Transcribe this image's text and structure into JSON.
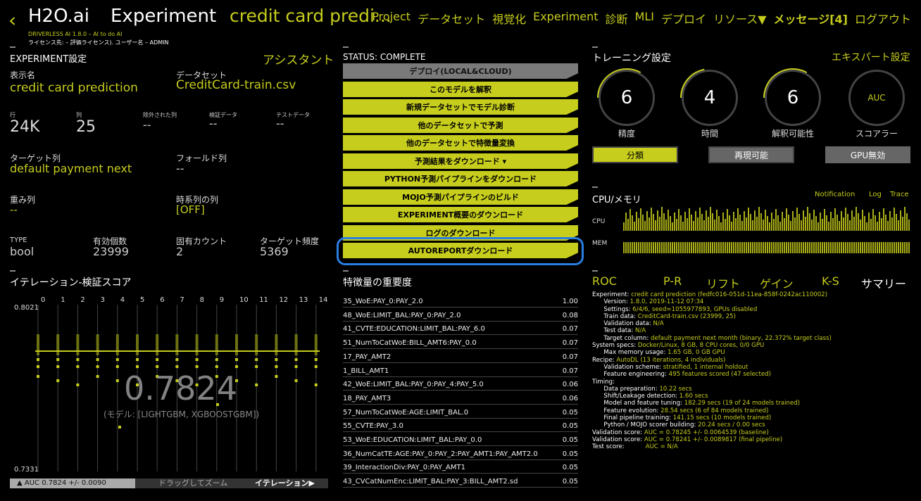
{
  "header": {
    "back_icon": "‹",
    "brand": "H2O.ai",
    "nav_experiment": "Experiment",
    "experiment_name": "credit card predi...",
    "version_line": "DRIVERLESS AI 1.8.0 – AI to do AI",
    "license_line": "ライセンス先:                – 評価ライセンス). ユーザー名 – ADMIN",
    "nav": [
      "Project",
      "データセット",
      "視覚化",
      "Experiment",
      "診断",
      "MLI",
      "デプロイ",
      "リソース▼",
      "メッセージ[4]",
      "ログアウト"
    ]
  },
  "settings": {
    "title": "EXPERIMENT設定",
    "assistant": "アシスタント",
    "display_name_label": "表示名",
    "display_name": "credit card prediction",
    "dataset_label": "データセット",
    "dataset": "CreditCard-train.csv",
    "rows_label": "行",
    "rows": "24K",
    "cols_label": "列",
    "cols": "25",
    "excluded_label": "除外された列",
    "excluded": "--",
    "validation_label": "検証データ",
    "validation": "--",
    "test_label": "テストデータ",
    "test": "--",
    "target_label": "ターゲット列",
    "target": "default payment next",
    "fold_label": "フォールド列",
    "fold": "--",
    "weight_label": "重み列",
    "weight": "--",
    "time_label": "時系列の列",
    "time": "[OFF]",
    "type_label": "TYPE",
    "type": "bool",
    "count_label": "有効個数",
    "count": "23999",
    "unique_label": "固有カウント",
    "unique": "2",
    "freq_label": "ターゲット頻度",
    "freq": "5369"
  },
  "iteration": {
    "title": "イテレーション-検証スコア",
    "ymax": "0.8021",
    "ymin": "0.7331",
    "score": "0.7824",
    "model": "(モデル: [LIGHTGBM, XGBOOSTGBM])",
    "ticks": [
      "0",
      "1",
      "2",
      "3",
      "4",
      "5",
      "6",
      "7",
      "8",
      "9",
      "10",
      "11",
      "12",
      "13",
      "14"
    ],
    "footer_left": "▲ AUC 0.7824 +/- 0.0090",
    "footer_mid": "ドラッグしてズーム",
    "footer_right": "イテレーション▶"
  },
  "status": {
    "title": "STATUS: COMPLETE",
    "buttons": [
      "デプロイ(LOCAL&CLOUD)",
      "このモデルを解釈",
      "新規データセットでモデル診断",
      "他のデータセットで予測",
      "他のデータセットで特徴量変換",
      "予測結果をダウンロード ▾",
      "PYTHON予測パイプラインをダウンロード",
      "MOJO予測パイプラインのビルド",
      "EXPERIMENT概要のダウンロード",
      "ログのダウンロード",
      "AUTOREPORTダウンロード"
    ]
  },
  "features": {
    "title": "特徴量の重要度",
    "rows": [
      [
        "35_WoE:PAY_0:PAY_2.0",
        "1.00"
      ],
      [
        "48_WoE:LIMIT_BAL:PAY_0:PAY_2.0",
        "0.08"
      ],
      [
        "41_CVTE:EDUCATION:LIMIT_BAL:PAY_6.0",
        "0.07"
      ],
      [
        "51_NumToCatWoE:BILL_AMT6:PAY_0.0",
        "0.07"
      ],
      [
        "17_PAY_AMT2",
        "0.07"
      ],
      [
        "1_BILL_AMT1",
        "0.07"
      ],
      [
        "42_WoE:LIMIT_BAL:PAY_0:PAY_4:PAY_5.0",
        "0.06"
      ],
      [
        "18_PAY_AMT3",
        "0.06"
      ],
      [
        "57_NumToCatWoE:AGE:LIMIT_BAL.0",
        "0.05"
      ],
      [
        "55_CVTE:PAY_3.0",
        "0.05"
      ],
      [
        "53_WoE:EDUCATION:LIMIT_BAL:PAY_0.0",
        "0.05"
      ],
      [
        "36_NumCatTE:AGE:PAY_0:PAY_2:PAY_AMT1:PAY_AMT2.0",
        "0.05"
      ],
      [
        "39_InteractionDiv:PAY_0:PAY_AMT1",
        "0.05"
      ],
      [
        "43_CVCatNumEnc:LIMIT_BAL:PAY_3:BILL_AMT2.sd",
        "0.05"
      ]
    ]
  },
  "training": {
    "title": "トレーニング設定",
    "expert": "エキスパート設定",
    "dials": [
      {
        "value": "6",
        "label": "精度",
        "fill": 0.6
      },
      {
        "value": "4",
        "label": "時間",
        "fill": 0.4
      },
      {
        "value": "6",
        "label": "解釈可能性",
        "fill": 0.6
      },
      {
        "value": "AUC",
        "label": "スコアラー",
        "fill": 0
      }
    ],
    "toggles": [
      "分類",
      "再現可能",
      "GPU無効"
    ]
  },
  "cpu": {
    "title": "CPU/メモリ",
    "links": [
      "Notification",
      "Log",
      "Trace"
    ],
    "cpu_label": "CPU",
    "mem_label": "MEM"
  },
  "tabs": [
    "ROC",
    "P-R",
    "リフト",
    "ゲイン",
    "K-S",
    "サマリー"
  ],
  "summary": [
    [
      "Experiment: ",
      "credit card prediction (fedfc016-051d-11ea-858f-0242ac110002)"
    ],
    [
      "      Version: ",
      "1.8.0, 2019-11-12 07:34"
    ],
    [
      "      Settings: ",
      "6/4/6, seed=1055977893, GPUs disabled"
    ],
    [
      "      Train data: ",
      "CreditCard-train.csv (23999, 25)"
    ],
    [
      "      Validation data: ",
      "N/A"
    ],
    [
      "      Test data: ",
      "N/A"
    ],
    [
      "      Target column: ",
      "default payment next month (binary, 22.372% target class)"
    ],
    [
      "System specs: ",
      "Docker/Linux, 8 GB, 8 CPU cores, 0/0 GPU"
    ],
    [
      "      Max memory usage: ",
      "1.65 GB, 0 GB GPU"
    ],
    [
      "Recipe: ",
      "AutoDL (13 iterations, 4 individuals)"
    ],
    [
      "      Validation scheme: ",
      "stratified, 1 internal holdout"
    ],
    [
      "      Feature engineering: ",
      "495 features scored (47 selected)"
    ],
    [
      "Timing:",
      ""
    ],
    [
      "      Data preparation: ",
      "10.22 secs"
    ],
    [
      "      Shift/Leakage detection: ",
      "1.60 secs"
    ],
    [
      "      Model and feature tuning: ",
      "182.29 secs (19 of 24 models trained)"
    ],
    [
      "      Feature evolution: ",
      "28.54 secs (6 of 84 models trained)"
    ],
    [
      "      Final pipeline training: ",
      "141.15 secs (10 models trained)"
    ],
    [
      "      Python / MOJO scorer building: ",
      "20.24 secs / 0.00 secs"
    ],
    [
      "Validation score: ",
      "AUC = 0.78245 +/- 0.0064539 (baseline)"
    ],
    [
      "Validation score: ",
      "AUC = 0.78241 +/- 0.0089817 (final pipeline)"
    ],
    [
      "Test score:           ",
      "AUC = N/A"
    ]
  ],
  "colors": {
    "accent": "#c6cd1c",
    "highlight": "#2a7de1"
  }
}
